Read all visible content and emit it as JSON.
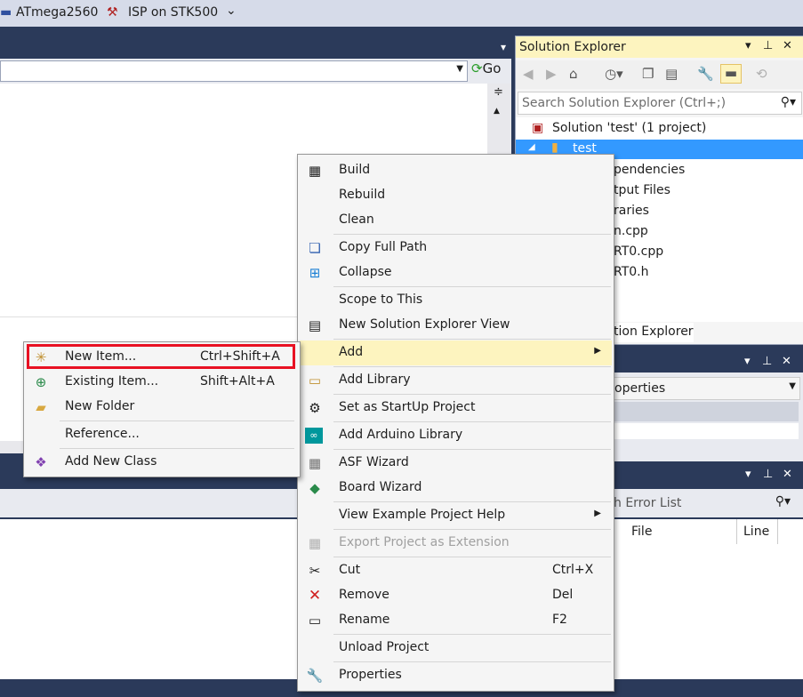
{
  "toolbar": {
    "device": "ATmega2560",
    "tool": "ISP on STK500"
  },
  "nav": {
    "go_label": "Go"
  },
  "solution_explorer": {
    "title": "Solution Explorer",
    "search_placeholder": "Search Solution Explorer (Ctrl+;)",
    "solution_label": "Solution 'test' (1 project)",
    "project_label": "test",
    "items": [
      "pendencies",
      "tput Files",
      "raries",
      "n.cpp",
      "RT0.cpp",
      "RT0.h"
    ],
    "tab_label": "tion Explorer"
  },
  "properties": {
    "combo_text": "operties"
  },
  "error_list": {
    "search_placeholder": "h Error List",
    "col_file": "File",
    "col_line": "Line"
  },
  "context_menu": {
    "build": "Build",
    "rebuild": "Rebuild",
    "clean": "Clean",
    "copy_full_path": "Copy Full Path",
    "collapse": "Collapse",
    "scope_to_this": "Scope to This",
    "new_se_view": "New Solution Explorer View",
    "add": "Add",
    "add_library": "Add Library",
    "set_startup": "Set as StartUp Project",
    "add_arduino_library": "Add Arduino Library",
    "asf_wizard": "ASF Wizard",
    "board_wizard": "Board Wizard",
    "view_example_help": "View Example Project Help",
    "export_extension": "Export Project as Extension",
    "cut": "Cut",
    "cut_sc": "Ctrl+X",
    "remove": "Remove",
    "remove_sc": "Del",
    "rename": "Rename",
    "rename_sc": "F2",
    "unload_project": "Unload Project",
    "properties": "Properties"
  },
  "add_submenu": {
    "new_item": "New Item...",
    "new_item_sc": "Ctrl+Shift+A",
    "existing_item": "Existing Item...",
    "existing_item_sc": "Shift+Alt+A",
    "new_folder": "New Folder",
    "reference": "Reference...",
    "add_new_class": "Add New Class"
  },
  "colors": {
    "accent_selection": "#3399ff",
    "menu_highlight": "#fdf4bf",
    "callout_red": "#e81123",
    "chrome_dark": "#2b3a5a"
  }
}
